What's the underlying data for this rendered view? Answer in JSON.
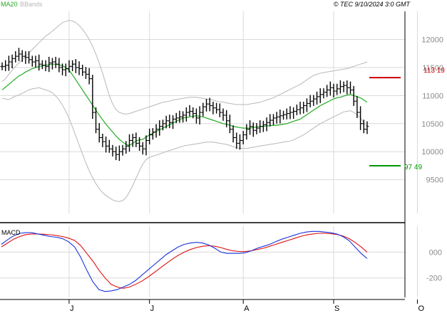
{
  "header": {
    "legend_ma": "MA20",
    "legend_bb": "BBands",
    "timestamp": "© TEC 9/10/2024 3:0 GMT"
  },
  "colors": {
    "price": "#000000",
    "ma20": "#22aa22",
    "bbands": "#b8b8b8",
    "resistance": "#cc0000",
    "support": "#009900",
    "macd": "#1a33dd",
    "signal": "#dd1111",
    "grid": "#d9d9d9",
    "axis": "#000000"
  },
  "levels": {
    "resistance_label": "113 19",
    "support_label": "97 49"
  },
  "macd_panel": {
    "label": "MACD"
  },
  "chart_data": [
    {
      "type": "bar",
      "subtype": "ohlc",
      "xlabel": "",
      "ylabel": "",
      "ylim": [
        8900,
        12500
      ],
      "y_ticks": [
        9500,
        10000,
        10500,
        11000,
        11500,
        12000
      ],
      "y_tick_labels": [
        "9500",
        "10000",
        "10500",
        "11000",
        "11500",
        "12000"
      ],
      "x_tick_labels": [
        "J",
        "J",
        "A",
        "S",
        "O"
      ],
      "x_tick_index": [
        20,
        44,
        72,
        99,
        124
      ],
      "grid": true,
      "legend": "top-left",
      "series": [
        {
          "name": "MA20",
          "values": [
            11100,
            11150,
            11200,
            11250,
            11300,
            11350,
            11380,
            11420,
            11450,
            11480,
            11500,
            11520,
            11530,
            11540,
            11550,
            11560,
            11560,
            11550,
            11530,
            11500,
            11450,
            11370,
            11280,
            11190,
            11100,
            11010,
            10920,
            10830,
            10740,
            10650,
            10570,
            10490,
            10420,
            10350,
            10280,
            10220,
            10170,
            10130,
            10110,
            10150,
            10190,
            10210,
            10220,
            10260,
            10300,
            10330,
            10360,
            10390,
            10420,
            10450,
            10480,
            10510,
            10540,
            10570,
            10600,
            10610,
            10620,
            10630,
            10640,
            10630,
            10620,
            10600,
            10580,
            10560,
            10540,
            10520,
            10500,
            10490,
            10470,
            10450,
            10440,
            10430,
            10420,
            10420,
            10420,
            10430,
            10440,
            10450,
            10450,
            10460,
            10460,
            10470,
            10470,
            10480,
            10490,
            10500,
            10520,
            10540,
            10560,
            10580,
            10620,
            10660,
            10700,
            10740,
            10780,
            10820,
            10850,
            10880,
            10910,
            10940,
            10960,
            10970,
            10990,
            11010,
            11020,
            11000,
            10980,
            10960,
            10920,
            10880
          ]
        },
        {
          "name": "BBands",
          "values": []
        },
        {
          "name": "",
          "values": []
        }
      ],
      "bb_upper": [
        11250,
        11300,
        11380,
        11450,
        11520,
        11580,
        11640,
        11700,
        11760,
        11820,
        11880,
        11940,
        12000,
        12060,
        12100,
        12150,
        12200,
        12250,
        12300,
        12320,
        12340,
        12330,
        12300,
        12250,
        12180,
        12100,
        12000,
        11880,
        11740,
        11580,
        11400,
        11200,
        11000,
        10850,
        10750,
        10700,
        10680,
        10670,
        10680,
        10700,
        10720,
        10740,
        10760,
        10780,
        10800,
        10820,
        10840,
        10860,
        10880,
        10890,
        10900,
        10920,
        10930,
        10940,
        10950,
        10960,
        10970,
        10970,
        10970,
        10960,
        10950,
        10940,
        10930,
        10920,
        10900,
        10890,
        10880,
        10870,
        10860,
        10850,
        10840,
        10840,
        10840,
        10840,
        10850,
        10860,
        10870,
        10880,
        10900,
        10920,
        10940,
        10960,
        10990,
        11020,
        11050,
        11080,
        11110,
        11140,
        11170,
        11200,
        11240,
        11280,
        11320,
        11360,
        11380,
        11400,
        11410,
        11420,
        11430,
        11440,
        11450,
        11460,
        11470,
        11480,
        11500,
        11520,
        11540,
        11560,
        11580,
        11600
      ],
      "bb_lower": [
        10950,
        10940,
        10930,
        10960,
        10990,
        11010,
        11040,
        11070,
        11100,
        11120,
        11130,
        11140,
        11120,
        11100,
        11080,
        11050,
        10990,
        10920,
        10830,
        10720,
        10600,
        10440,
        10280,
        10120,
        9960,
        9800,
        9660,
        9540,
        9430,
        9340,
        9270,
        9220,
        9180,
        9140,
        9120,
        9110,
        9130,
        9180,
        9280,
        9400,
        9530,
        9660,
        9780,
        9860,
        9900,
        9920,
        9940,
        9960,
        9980,
        10000,
        10020,
        10040,
        10060,
        10080,
        10100,
        10110,
        10120,
        10130,
        10140,
        10150,
        10160,
        10170,
        10170,
        10170,
        10160,
        10150,
        10140,
        10130,
        10110,
        10090,
        10070,
        10060,
        10060,
        10060,
        10070,
        10080,
        10090,
        10100,
        10110,
        10120,
        10130,
        10140,
        10150,
        10160,
        10170,
        10180,
        10190,
        10210,
        10240,
        10270,
        10300,
        10340,
        10380,
        10420,
        10460,
        10500,
        10530,
        10560,
        10590,
        10620,
        10650,
        10680,
        10710,
        10720,
        10730,
        10700,
        10660,
        10600,
        10520,
        10440
      ],
      "close": [
        11520,
        11540,
        11600,
        11660,
        11700,
        11740,
        11700,
        11680,
        11640,
        11600,
        11620,
        11560,
        11540,
        11520,
        11580,
        11600,
        11560,
        11500,
        11460,
        11480,
        11520,
        11560,
        11500,
        11480,
        11420,
        11380,
        11300,
        10700,
        10400,
        10250,
        10180,
        10100,
        10050,
        10000,
        9950,
        10000,
        10050,
        10100,
        10200,
        10250,
        10150,
        10100,
        10050,
        10200,
        10300,
        10350,
        10400,
        10450,
        10500,
        10550,
        10520,
        10580,
        10600,
        10620,
        10650,
        10700,
        10720,
        10680,
        10600,
        10700,
        10800,
        10850,
        10820,
        10780,
        10750,
        10700,
        10650,
        10550,
        10400,
        10250,
        10150,
        10200,
        10300,
        10400,
        10450,
        10380,
        10420,
        10450,
        10480,
        10520,
        10560,
        10600,
        10620,
        10640,
        10660,
        10680,
        10700,
        10720,
        10750,
        10780,
        10820,
        10860,
        10900,
        10940,
        10980,
        11020,
        11060,
        11100,
        11140,
        11080,
        11120,
        11160,
        11180,
        11140,
        11100,
        10900,
        10700,
        10500,
        10400,
        10450
      ]
    },
    {
      "type": "line",
      "title": "MACD",
      "ylim": [
        -350,
        200
      ],
      "y_ticks": [
        0,
        -200
      ],
      "y_tick_labels": [
        "000",
        "-200"
      ],
      "grid": true,
      "series": [
        {
          "name": "",
          "values": [
            60,
            95,
            125,
            145,
            150,
            150,
            140,
            130,
            120,
            115,
            105,
            80,
            40,
            -40,
            -140,
            -230,
            -290,
            -305,
            -300,
            -290,
            -270,
            -250,
            -220,
            -180,
            -140,
            -100,
            -60,
            -20,
            10,
            40,
            60,
            70,
            75,
            70,
            55,
            30,
            0,
            -10,
            -10,
            -10,
            -5,
            10,
            30,
            45,
            60,
            80,
            100,
            115,
            130,
            145,
            155,
            160,
            160,
            155,
            150,
            140,
            120,
            90,
            40,
            -10,
            -50
          ]
        },
        {
          "name": "",
          "values": [
            40,
            70,
            100,
            120,
            135,
            140,
            140,
            138,
            134,
            128,
            120,
            108,
            90,
            50,
            -10,
            -70,
            -140,
            -200,
            -250,
            -270,
            -280,
            -270,
            -250,
            -225,
            -195,
            -160,
            -125,
            -90,
            -55,
            -25,
            0,
            20,
            35,
            45,
            50,
            45,
            35,
            20,
            10,
            5,
            5,
            10,
            20,
            30,
            45,
            60,
            75,
            90,
            105,
            120,
            132,
            140,
            145,
            145,
            142,
            136,
            125,
            105,
            75,
            40,
            0
          ]
        }
      ]
    }
  ]
}
